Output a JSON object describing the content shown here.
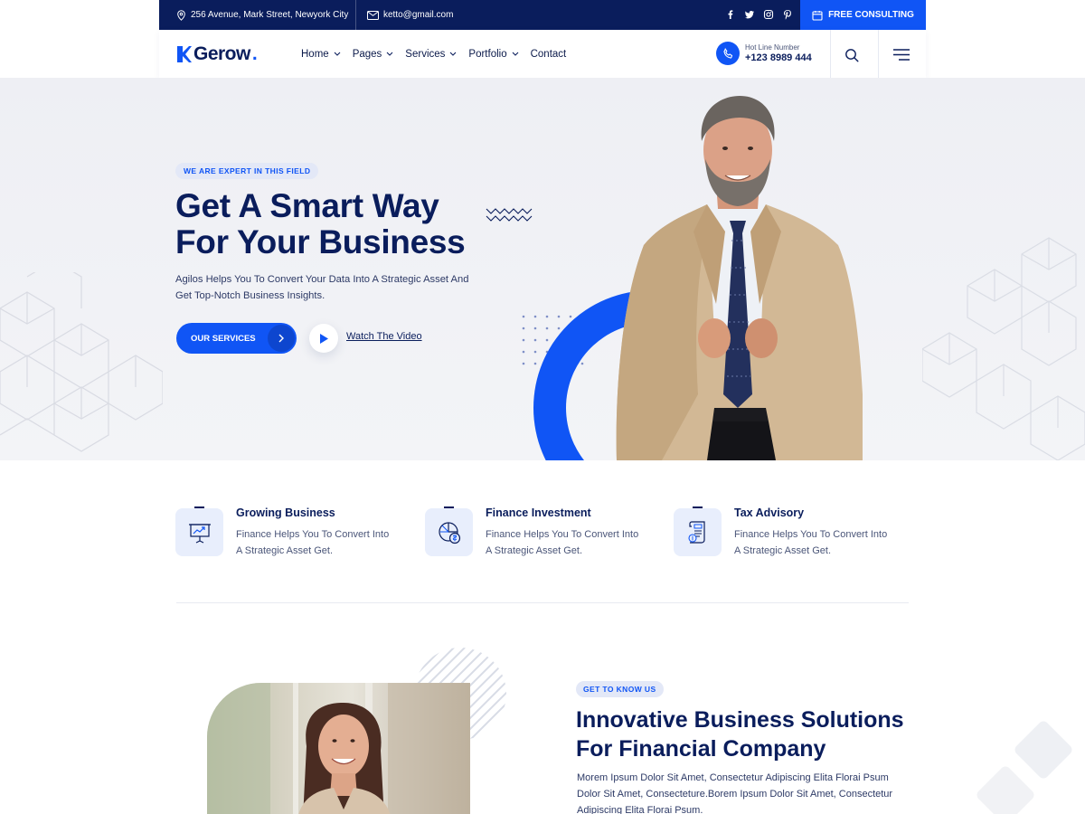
{
  "topbar": {
    "address": "256 Avenue, Mark Street, Newyork City",
    "email": "ketto@gmail.com",
    "social_icons": [
      "facebook-icon",
      "twitter-icon",
      "instagram-icon",
      "pinterest-icon"
    ],
    "cta_label": "FREE CONSULTING",
    "background_color": "#0a1d5c",
    "accent_color": "#1055f5"
  },
  "nav": {
    "logo_text": "Gerow",
    "logo_dot": ".",
    "items": [
      {
        "label": "Home",
        "has_dropdown": true
      },
      {
        "label": "Pages",
        "has_dropdown": true
      },
      {
        "label": "Services",
        "has_dropdown": true
      },
      {
        "label": "Portfolio",
        "has_dropdown": true
      },
      {
        "label": "Contact",
        "has_dropdown": false
      }
    ],
    "hotline_label": "Hot Line Number",
    "hotline_number": "+123 8989 444"
  },
  "hero": {
    "badge": "WE ARE EXPERT IN THIS FIELD",
    "title_line1": "Get A Smart Way",
    "title_line2": "For Your Business",
    "subtitle": "Agilos Helps You To Convert Your Data Into A Strategic Asset And Get Top-Notch Business Insights.",
    "primary_button": "OUR SERVICES",
    "video_link": "Watch The Video"
  },
  "features": [
    {
      "title": "Growing Business",
      "description": "Finance Helps You To Convert Into A Strategic Asset Get.",
      "icon": "presentation-chart-icon"
    },
    {
      "title": "Finance Investment",
      "description": "Finance Helps You To Convert Into A Strategic Asset Get.",
      "icon": "pie-chart-dollar-icon"
    },
    {
      "title": "Tax Advisory",
      "description": "Finance Helps You To Convert Into A Strategic Asset Get.",
      "icon": "tax-document-icon"
    }
  ],
  "about": {
    "badge": "GET TO KNOW US",
    "title_line1": "Innovative Business Solutions",
    "title_line2": "For Financial Company",
    "text": "Morem Ipsum Dolor Sit Amet, Consectetur Adipiscing Elita Florai Psum Dolor Sit Amet, Consecteture.Borem Ipsum Dolor Sit Amet, Consectetur Adipiscing Elita Florai Psum."
  }
}
